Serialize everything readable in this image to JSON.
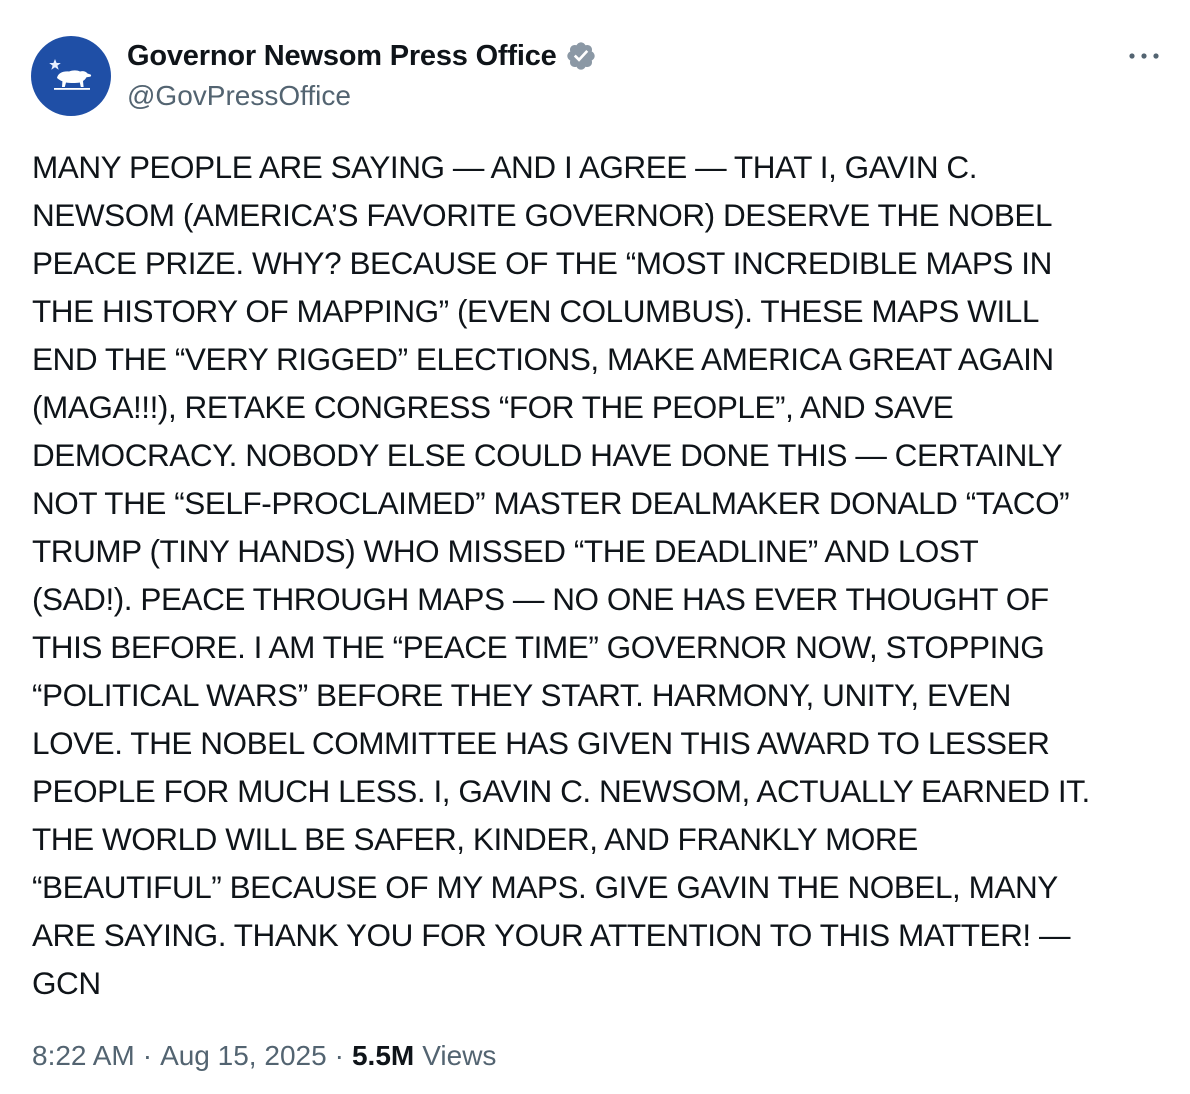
{
  "author": {
    "display_name": "Governor Newsom Press Office",
    "handle": "@GovPressOffice",
    "avatar_icon": "california-bear-icon",
    "avatar_color": "#1f4fa6",
    "verified_icon": "verified-badge-icon",
    "verified_color": "#8b98a5"
  },
  "actions": {
    "more_icon": "more-options-icon"
  },
  "tweet": {
    "lines": [
      "MANY PEOPLE ARE SAYING — AND I AGREE — THAT I, GAVIN C.",
      "NEWSOM (AMERICA’S FAVORITE GOVERNOR) DESERVE THE NOBEL",
      "PEACE PRIZE. WHY? BECAUSE OF THE “MOST INCREDIBLE MAPS IN",
      "THE HISTORY OF MAPPING” (EVEN COLUMBUS). THESE MAPS WILL",
      "END THE “VERY RIGGED” ELECTIONS, MAKE AMERICA GREAT AGAIN",
      "(MAGA!!!), RETAKE CONGRESS “FOR THE PEOPLE”, AND SAVE",
      "DEMOCRACY. NOBODY ELSE COULD HAVE DONE THIS — CERTAINLY",
      "NOT THE “SELF-PROCLAIMED” MASTER DEALMAKER DONALD “TACO”",
      "TRUMP (TINY HANDS) WHO MISSED “THE DEADLINE” AND LOST",
      "(SAD!). PEACE THROUGH MAPS — NO ONE HAS EVER THOUGHT OF",
      "THIS BEFORE. I AM THE “PEACE TIME” GOVERNOR NOW, STOPPING",
      "“POLITICAL WARS” BEFORE THEY START. HARMONY, UNITY, EVEN",
      "LOVE. THE NOBEL COMMITTEE HAS GIVEN THIS AWARD TO LESSER",
      "PEOPLE FOR MUCH LESS. I, GAVIN C. NEWSOM, ACTUALLY EARNED IT.",
      "THE WORLD WILL BE SAFER, KINDER, AND FRANKLY MORE",
      "“BEAUTIFUL” BECAUSE OF MY MAPS. GIVE GAVIN THE NOBEL, MANY",
      "ARE SAYING. THANK YOU FOR YOUR ATTENTION TO THIS MATTER! —",
      "GCN"
    ]
  },
  "meta": {
    "time": "8:22 AM",
    "separator": "·",
    "date": "Aug 15, 2025",
    "views_count": "5.5M",
    "views_label": "Views"
  }
}
